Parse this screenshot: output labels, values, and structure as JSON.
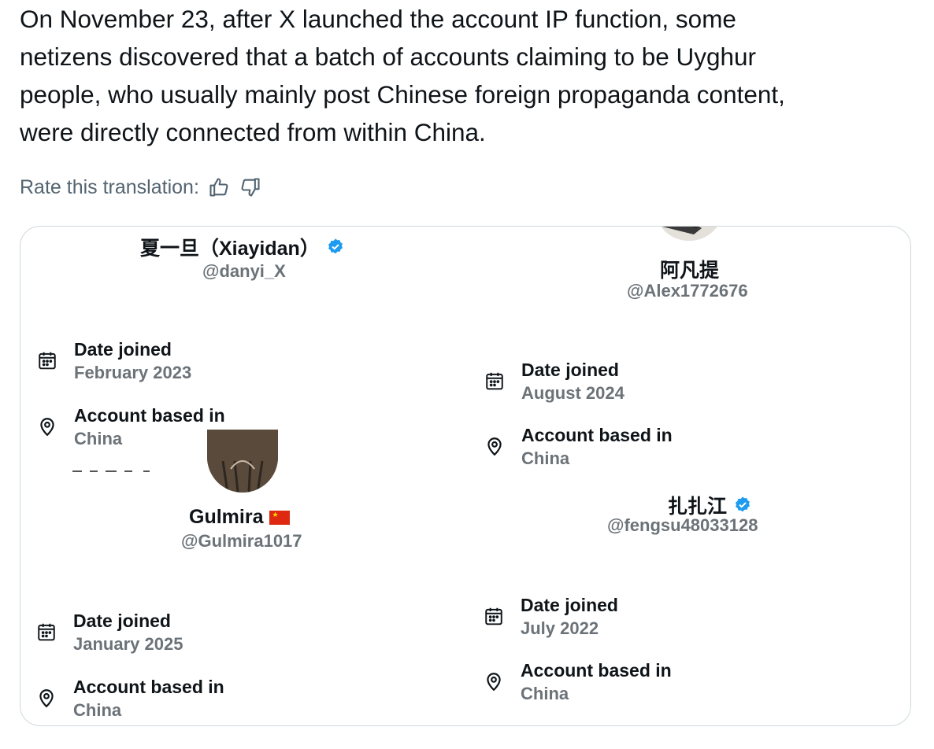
{
  "tweet": {
    "lines": [
      "On November 23, after X launched the account IP function, some",
      "netizens discovered that a batch of accounts claiming to be Uyghur",
      "people, who usually mainly post Chinese foreign propaganda content,",
      "were directly connected from within China."
    ]
  },
  "translation": {
    "rate_label": "Rate this translation:",
    "thumbs_up_icon": "thumbs-up-icon",
    "thumbs_down_icon": "thumbs-down-icon"
  },
  "accounts": [
    {
      "name": "夏一旦（Xiayidan）",
      "verified": true,
      "handle": "@danyi_X",
      "joined_label": "Date joined",
      "joined_value": "February 2023",
      "based_label": "Account based in",
      "based_value": "China"
    },
    {
      "name": "阿凡提",
      "verified": false,
      "handle": "@Alex1772676",
      "joined_label": "Date joined",
      "joined_value": "August 2024",
      "based_label": "Account based in",
      "based_value": "China"
    },
    {
      "name": "Gulmira",
      "flag": "china-flag",
      "handle": "@Gulmira1017",
      "joined_label": "Date joined",
      "joined_value": "January 2025",
      "based_label": "Account based in",
      "based_value": "China"
    },
    {
      "name": "扎扎江",
      "verified": true,
      "handle": "@fengsu48033128",
      "joined_label": "Date joined",
      "joined_value": "July 2022",
      "based_label": "Account based in",
      "based_value": "China"
    }
  ],
  "colors": {
    "text": "#0f1419",
    "muted": "#536471",
    "verified": "#1d9bf0",
    "border": "#cfd9de"
  }
}
